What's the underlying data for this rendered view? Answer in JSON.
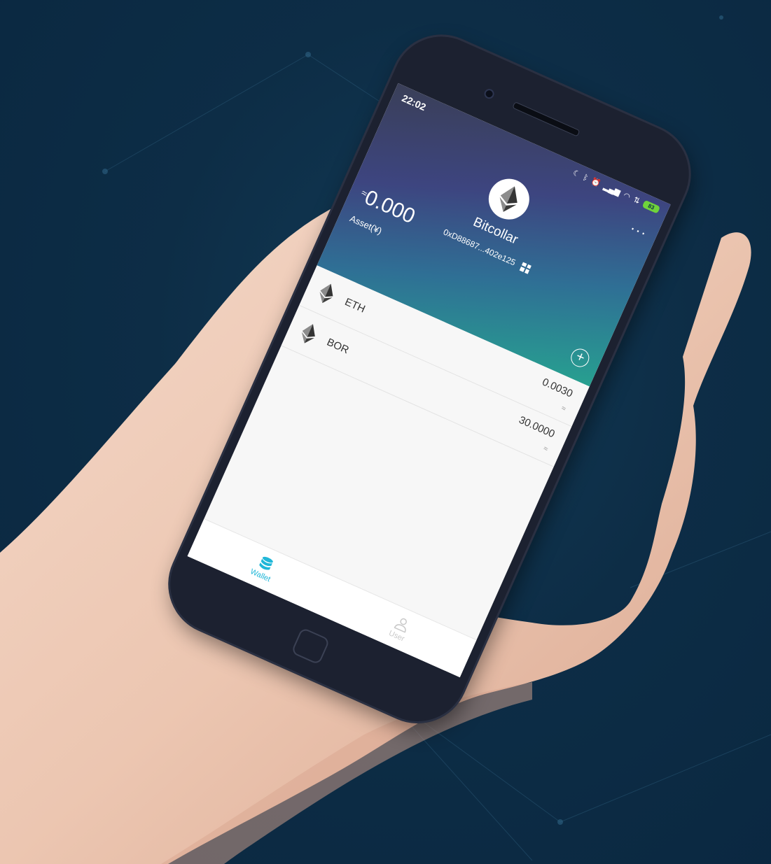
{
  "status_bar": {
    "time": "22:02",
    "icons": [
      "moon-icon",
      "bluetooth-icon",
      "alarm-icon",
      "signal-icon",
      "signal-icon",
      "wifi-icon",
      "data-icon"
    ],
    "battery": "83"
  },
  "wallet": {
    "name": "Bitcollar",
    "address": "0xD88687...402e125",
    "balance_prefix": "≈",
    "balance": "0.000",
    "balance_label": "Asset(¥)",
    "more": "···"
  },
  "tokens": [
    {
      "symbol": "ETH",
      "balance": "0.0030",
      "value": "≈"
    },
    {
      "symbol": "BOR",
      "balance": "30.0000",
      "value": "≈"
    }
  ],
  "add_label": "+",
  "tabs": [
    {
      "label": "Wallet",
      "active": true
    },
    {
      "label": "User",
      "active": false
    }
  ],
  "colors": {
    "accent": "#20b7d8",
    "background": "#0d2d46",
    "battery": "#6fd33b"
  }
}
